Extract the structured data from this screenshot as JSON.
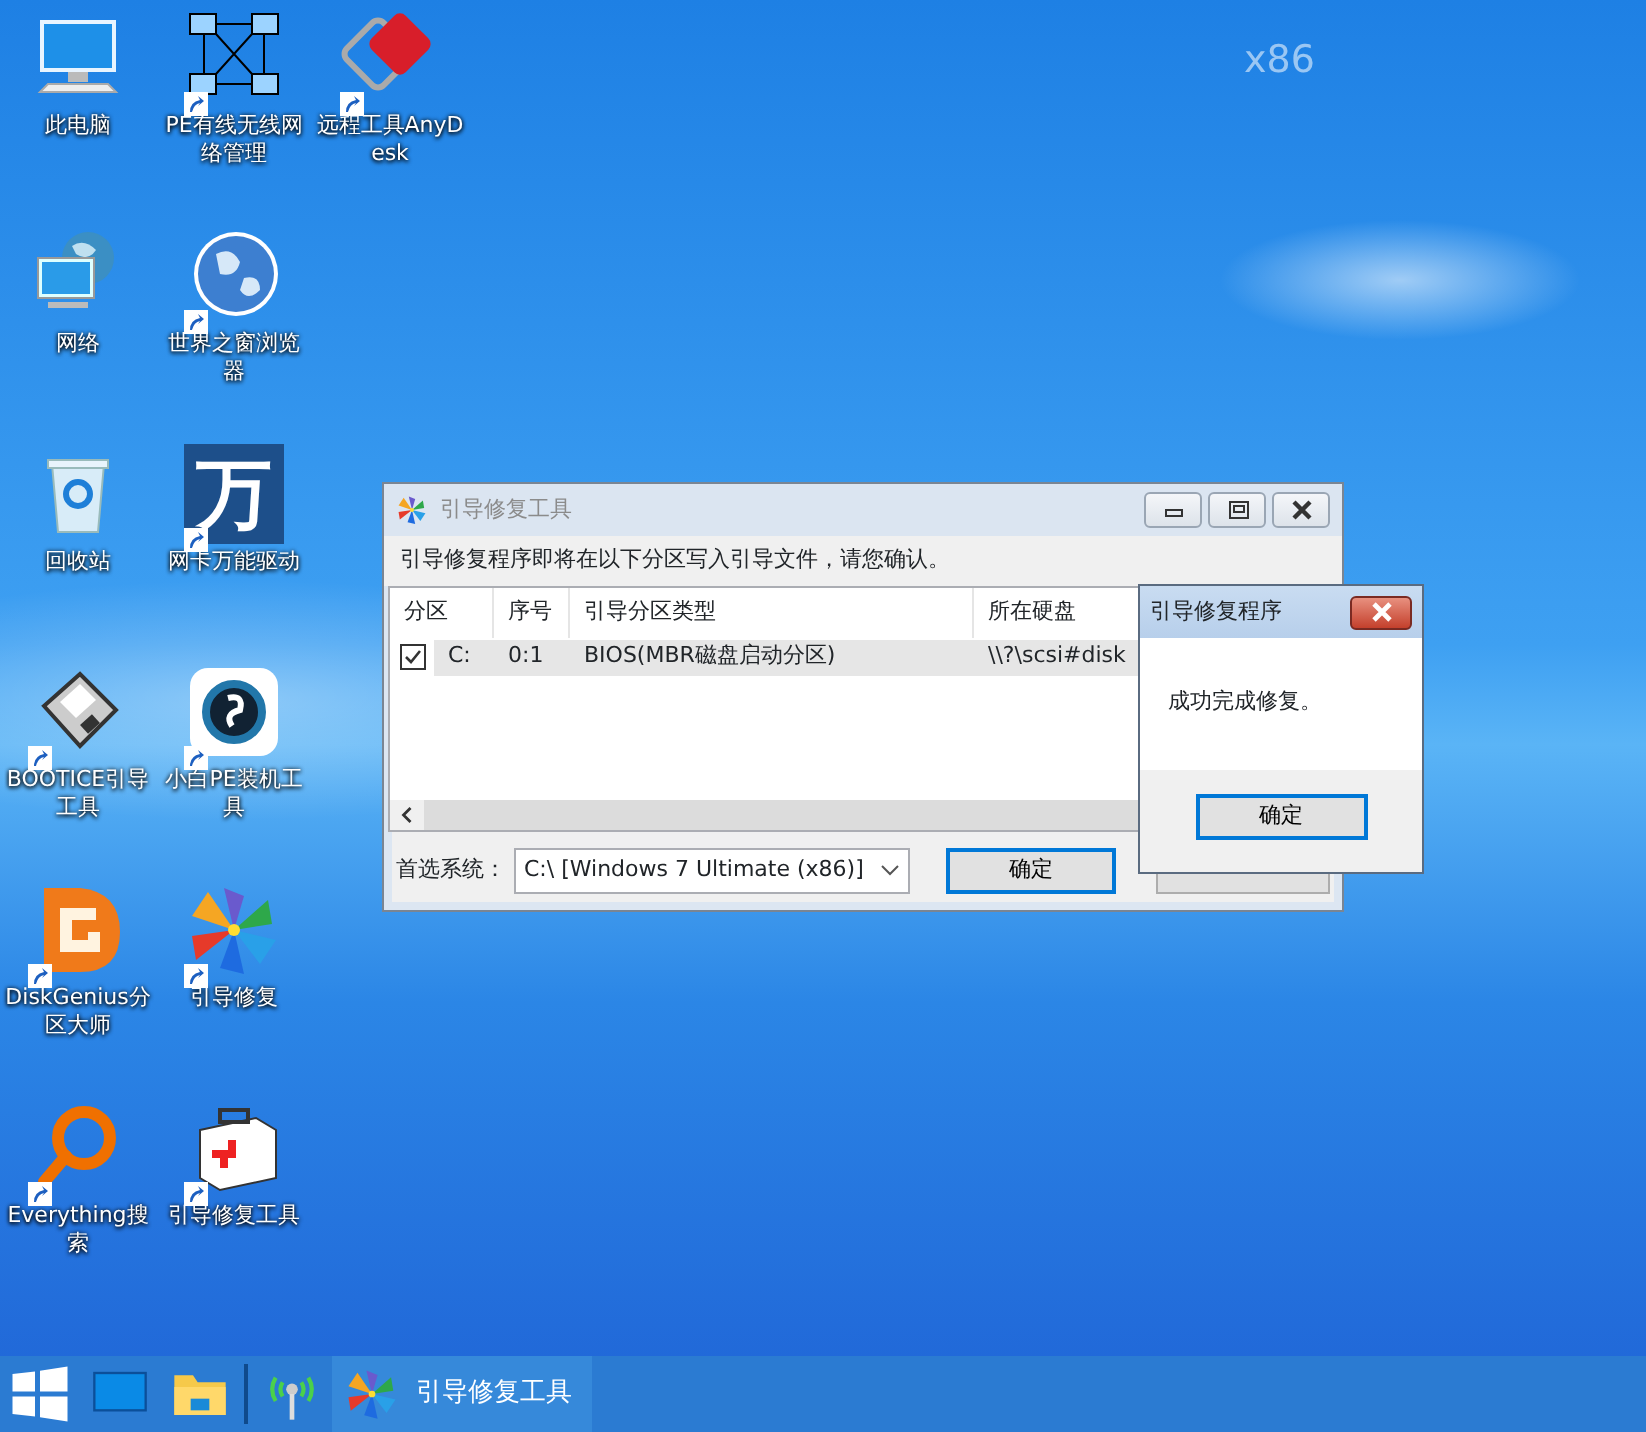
{
  "desktop": {
    "wallpaper_label": "x86",
    "icons": [
      {
        "kind": "computer",
        "label": "此电脑",
        "shortcut": false
      },
      {
        "kind": "network",
        "label": "网络",
        "shortcut": false
      },
      {
        "kind": "recycle",
        "label": "回收站",
        "shortcut": false
      },
      {
        "kind": "floppy",
        "label": "BOOTICE引导工具",
        "shortcut": true
      },
      {
        "kind": "diskgenius",
        "label": "DiskGenius分区大师",
        "shortcut": true
      },
      {
        "kind": "magnifier",
        "label": "Everything搜索",
        "shortcut": true
      },
      {
        "kind": "lan",
        "label": "PE有线无线网络管理",
        "shortcut": true
      },
      {
        "kind": "globe",
        "label": "世界之窗浏览器",
        "shortcut": true
      },
      {
        "kind": "tile",
        "glyph": "万",
        "label": "网卡万能驱动",
        "shortcut": true
      },
      {
        "kind": "app",
        "label": "小白PE装机工具",
        "shortcut": true
      },
      {
        "kind": "pinwheel",
        "label": "引导修复",
        "shortcut": true
      },
      {
        "kind": "medkit",
        "label": "引导修复工具",
        "shortcut": true
      },
      {
        "kind": "remote",
        "label": "远程工具AnyDesk",
        "shortcut": true
      }
    ]
  },
  "main_window": {
    "title": "引导修复工具",
    "message": "引导修复程序即将在以下分区写入引导文件，请您确认。",
    "columns": [
      "分区",
      "序号",
      "引导分区类型",
      "所在硬盘"
    ],
    "rows": [
      {
        "checked": true,
        "selected": true,
        "cells": [
          "C:",
          "0:1",
          "BIOS(MBR磁盘启动分区)",
          "\\\\?\\scsi#disk"
        ]
      }
    ],
    "preferred_label": "首选系统：",
    "preferred_value": "C:\\ [Windows 7 Ultimate (x86)]",
    "ok_button": "确定"
  },
  "dialog": {
    "title": "引导修复程序",
    "message": "成功完成修复。",
    "ok_button": "确定"
  },
  "taskbar": {
    "items": [
      {
        "kind": "start"
      },
      {
        "kind": "desktop"
      },
      {
        "kind": "explorer"
      },
      {
        "kind": "separator"
      },
      {
        "kind": "antenna"
      },
      {
        "kind": "app",
        "label": "引导修复工具",
        "selected": true
      }
    ]
  }
}
